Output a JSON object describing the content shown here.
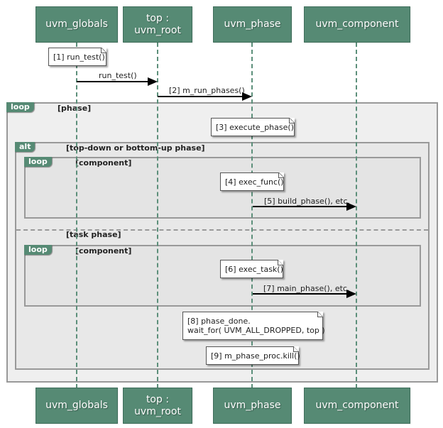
{
  "participants": [
    {
      "id": "uvm_globals",
      "label": "uvm_globals"
    },
    {
      "id": "top_uvm_root",
      "label": "top :\nuvm_root"
    },
    {
      "id": "uvm_phase",
      "label": "uvm_phase"
    },
    {
      "id": "uvm_component",
      "label": "uvm_component"
    }
  ],
  "colors": {
    "participant_fill": "#568a74",
    "lifeline": "#5c8f7a",
    "frame_border": "#999999"
  },
  "notes": {
    "n1": "[1] run_test()",
    "n3": "[3] execute_phase()",
    "n4": "[4] exec_func()",
    "n6": "[6] exec_task()",
    "n8": "[8] phase_done.\nwait_for( UVM_ALL_DROPPED, top )",
    "n9": "[9] m_phase_proc.kill()"
  },
  "messages": {
    "m1": {
      "label": "run_test()",
      "from": "uvm_globals",
      "to": "top_uvm_root"
    },
    "m2": {
      "label": "[2] m_run_phases()",
      "from": "top_uvm_root",
      "to": "uvm_phase"
    },
    "m5": {
      "label": "[5] build_phase(), etc.",
      "from": "uvm_phase",
      "to": "uvm_component"
    },
    "m7": {
      "label": "[7] main_phase(), etc.",
      "from": "uvm_phase",
      "to": "uvm_component"
    }
  },
  "frames": {
    "outer_loop": {
      "tag": "loop",
      "guard": "[phase]"
    },
    "alt": {
      "tag": "alt",
      "guard": "[top-down or bottom-up phase]",
      "else_guard": "[task phase]"
    },
    "inner_loop_1": {
      "tag": "loop",
      "guard": "[component]"
    },
    "inner_loop_2": {
      "tag": "loop",
      "guard": "[component]"
    }
  }
}
